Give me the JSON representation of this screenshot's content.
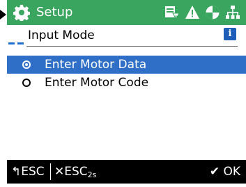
{
  "header": {
    "title": "Setup",
    "icons": [
      "gear-icon",
      "motor-data-icon",
      "warning-icon",
      "drive-status-icon",
      "network-icon"
    ]
  },
  "subheader": {
    "label": "Input Mode",
    "info_icon": "i"
  },
  "options": [
    {
      "label": "Enter Motor Data",
      "selected": true
    },
    {
      "label": "Enter Motor Code",
      "selected": false
    }
  ],
  "footer": {
    "back": "↰ESC",
    "esc_prefix": "✕ESC",
    "esc_sub": "2s",
    "ok": "✔ OK"
  },
  "colors": {
    "header_bg": "#3aa55f",
    "selection": "#2f6fc7",
    "footer_bg": "#000000"
  }
}
